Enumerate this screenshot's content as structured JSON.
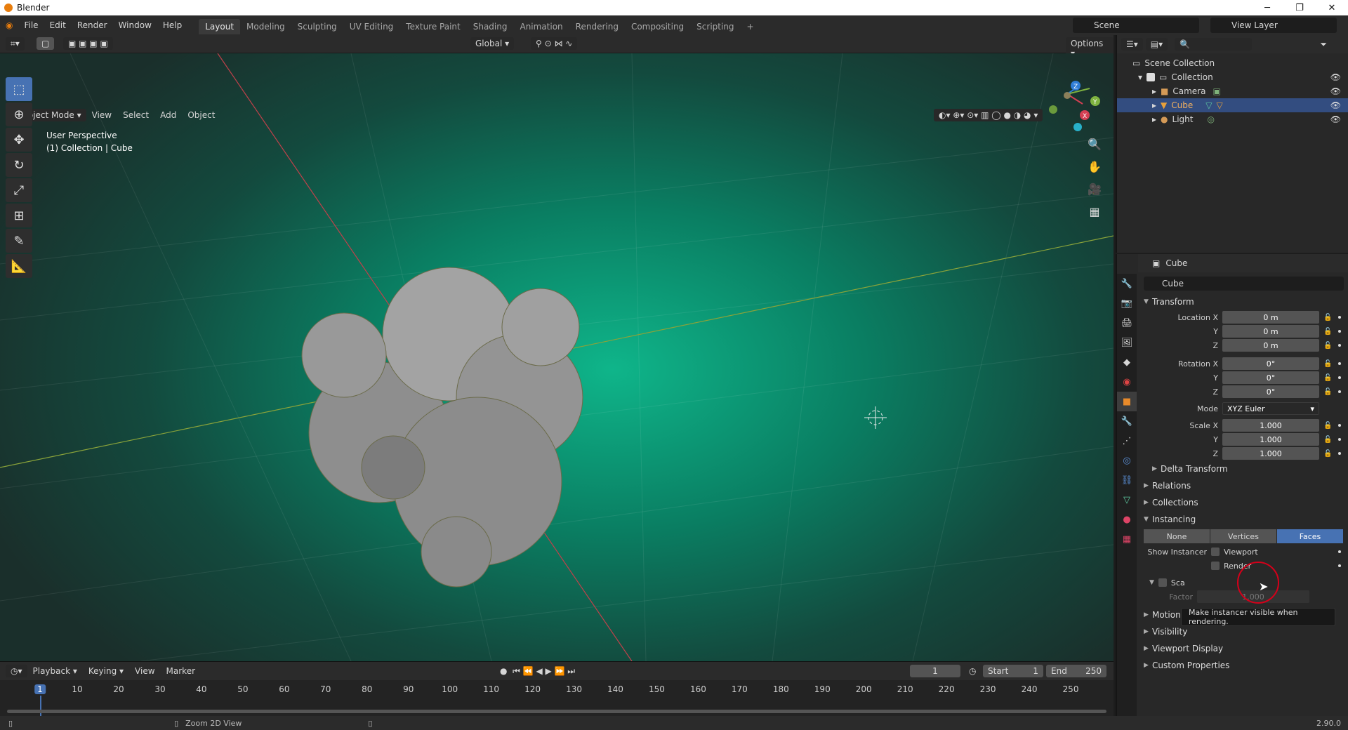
{
  "window": {
    "title": "Blender",
    "minimize": "─",
    "restore": "❐",
    "close": "✕"
  },
  "menu": [
    "File",
    "Edit",
    "Render",
    "Window",
    "Help"
  ],
  "workspaces": [
    "Layout",
    "Modeling",
    "Sculpting",
    "UV Editing",
    "Texture Paint",
    "Shading",
    "Animation",
    "Rendering",
    "Compositing",
    "Scripting",
    "+"
  ],
  "active_workspace": "Layout",
  "scene": "Scene",
  "view_layer": "View Layer",
  "toolheader": {
    "orientation": "Global",
    "options": "Options"
  },
  "viewport_header": {
    "mode": "Object Mode",
    "menus": [
      "View",
      "Select",
      "Add",
      "Object"
    ]
  },
  "viewport": {
    "line1": "User Perspective",
    "line2": "(1) Collection | Cube"
  },
  "gizmo": {
    "x": "X",
    "y": "Y",
    "z": "Z"
  },
  "outliner": {
    "root": "Scene Collection",
    "collection": "Collection",
    "items": [
      "Camera",
      "Cube",
      "Light"
    ],
    "selected": "Cube"
  },
  "props": {
    "header": "Cube",
    "name": "Cube",
    "transform": {
      "title": "Transform",
      "loc_label": "Location X",
      "loc": [
        "0 m",
        "0 m",
        "0 m"
      ],
      "rot_label": "Rotation X",
      "rot": [
        "0°",
        "0°",
        "0°"
      ],
      "mode_label": "Mode",
      "mode": "XYZ Euler",
      "scale_label": "Scale X",
      "scale": [
        "1.000",
        "1.000",
        "1.000"
      ],
      "y": "Y",
      "z": "Z"
    },
    "delta": "Delta Transform",
    "relations": "Relations",
    "collections": "Collections",
    "instancing": {
      "title": "Instancing",
      "options": [
        "None",
        "Vertices",
        "Faces"
      ],
      "selected": "Faces",
      "show_label": "Show Instancer",
      "viewport": "Viewport",
      "render": "Render",
      "scale_label": "Sca",
      "factor_label": "Factor",
      "factor": "1.000"
    },
    "motion_paths": "Motion Paths",
    "visibility": "Visibility",
    "viewport_display": "Viewport Display",
    "custom_props": "Custom Properties"
  },
  "tooltip": "Make instancer visible when rendering.",
  "timeline": {
    "menus": [
      "Playback",
      "Keying",
      "View",
      "Marker"
    ],
    "current": "1",
    "start_label": "Start",
    "start": "1",
    "end_label": "End",
    "end": "250",
    "ticks": [
      "1",
      "10",
      "20",
      "30",
      "40",
      "50",
      "60",
      "70",
      "80",
      "90",
      "100",
      "110",
      "120",
      "130",
      "140",
      "150",
      "160",
      "170",
      "180",
      "190",
      "200",
      "210",
      "220",
      "230",
      "240",
      "250"
    ]
  },
  "status": {
    "hint": "Zoom 2D View",
    "version": "2.90.0"
  }
}
